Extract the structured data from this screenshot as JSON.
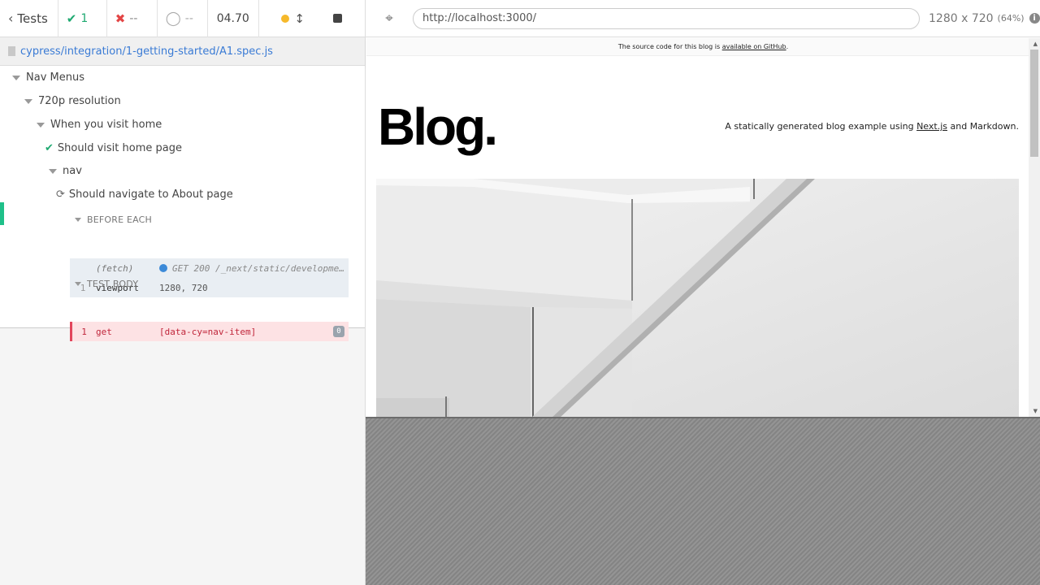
{
  "reporter": {
    "tests_label": "Tests",
    "stats": {
      "passed": "1",
      "failed": "--",
      "pending": "--"
    },
    "duration": "04.70",
    "spec_path": "cypress/integration/1-getting-started/A1.spec.js",
    "tree": {
      "suite1": "Nav Menus",
      "suite2": "720p resolution",
      "suite3": "When you visit home",
      "test_passed": "Should visit home page",
      "suite4": "nav",
      "test_running": "Should navigate to About page",
      "before_each": "BEFORE EACH",
      "test_body": "TEST BODY"
    },
    "commands": {
      "fetch": {
        "name": "(fetch)",
        "message": "GET 200 /_next/static/development/..."
      },
      "viewport": {
        "num": "1",
        "name": "viewport",
        "message": "1280, 720"
      },
      "get": {
        "num": "1",
        "name": "get",
        "message": "[data-cy=nav-item]",
        "count": "0"
      }
    }
  },
  "aut": {
    "url": "http://localhost:3000/",
    "viewport_size": "1280 x 720",
    "zoom": "(64%)",
    "banner": {
      "prefix": "The source code for this blog is ",
      "link": "available on GitHub",
      "suffix": "."
    },
    "blog_title": "Blog.",
    "tagline": {
      "prefix": "A statically generated blog example using ",
      "link": "Next.js",
      "suffix": " and Markdown."
    }
  },
  "colors": {
    "passed": "#1fa971",
    "failed": "#e34545",
    "link": "#3a7bd5",
    "error_row": "#fde2e4"
  }
}
